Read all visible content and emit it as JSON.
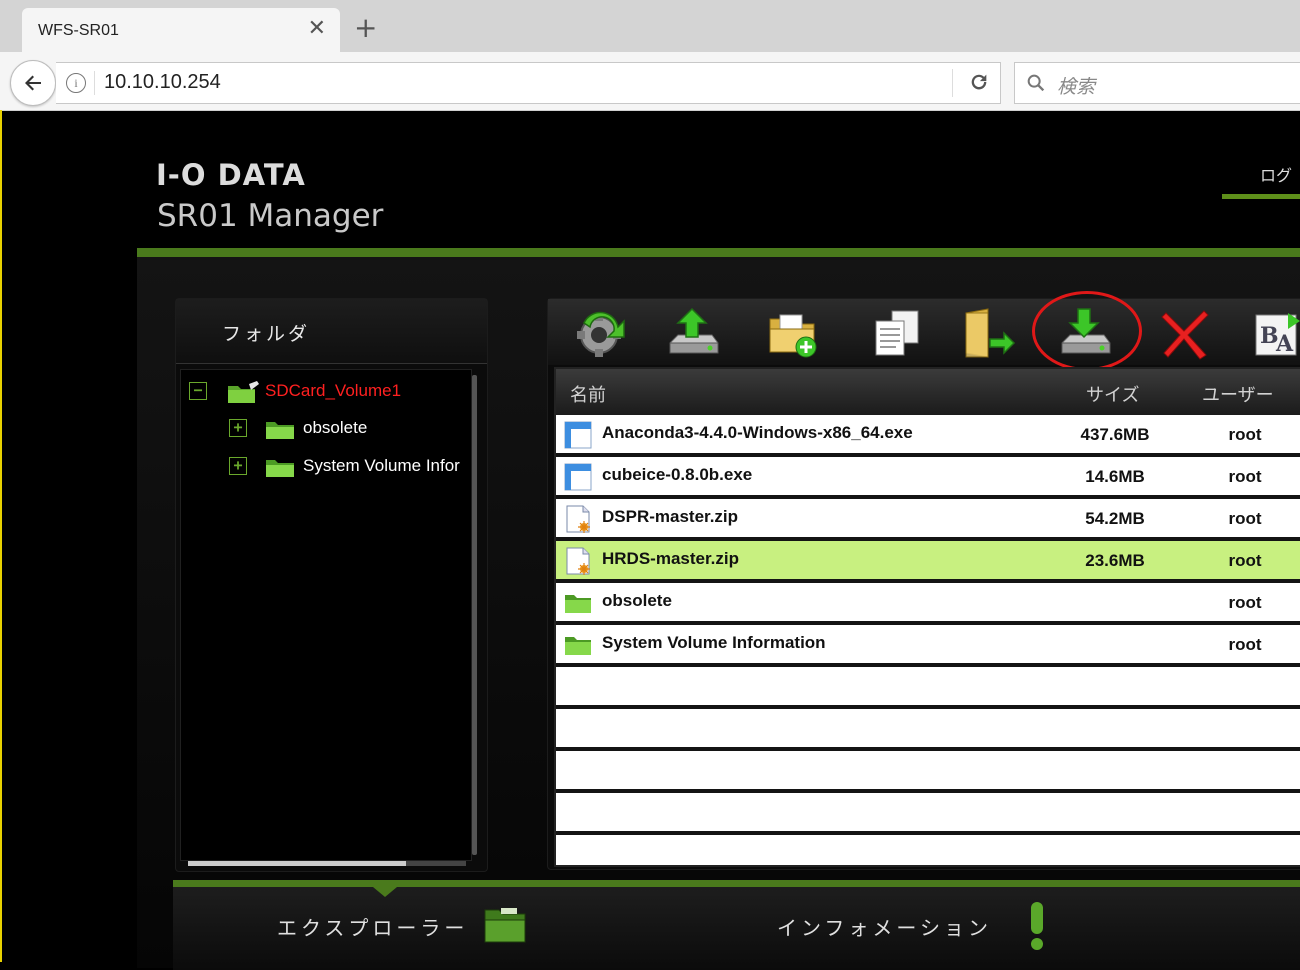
{
  "browser": {
    "tab_title": "WFS-SR01",
    "tab_close": "✕",
    "new_tab": "+",
    "url": "10.10.10.254",
    "search_placeholder": "検索"
  },
  "app": {
    "logo": "I-O DATA",
    "app_name": "SR01 Manager",
    "login_tab": "ログ"
  },
  "folder_panel": {
    "title": "フォルダ",
    "tree": [
      {
        "label": "SDCard_Volume1",
        "toggle": "−",
        "color": "#ff2020"
      },
      {
        "label": "obsolete",
        "toggle": "+",
        "color": "#ffffff"
      },
      {
        "label": "System Volume Infor",
        "toggle": "+",
        "color": "#ffffff"
      }
    ]
  },
  "action_bar": {
    "items": [
      "refresh-icon",
      "upload-icon",
      "new-folder-icon",
      "copy-icon",
      "move-icon",
      "download-icon",
      "delete-icon",
      "rename-icon"
    ]
  },
  "file_list": {
    "columns": {
      "name": "名前",
      "size": "サイズ",
      "user": "ユーザー"
    },
    "rows": [
      {
        "name": "Anaconda3-4.4.0-Windows-x86_64.exe",
        "size": "437.6MB",
        "user": "root",
        "type": "exe",
        "selected": false
      },
      {
        "name": "cubeice-0.8.0b.exe",
        "size": "14.6MB",
        "user": "root",
        "type": "exe",
        "selected": false
      },
      {
        "name": "DSPR-master.zip",
        "size": "54.2MB",
        "user": "root",
        "type": "zip",
        "selected": false
      },
      {
        "name": "HRDS-master.zip",
        "size": "23.6MB",
        "user": "root",
        "type": "zip",
        "selected": true
      },
      {
        "name": "obsolete",
        "size": "",
        "user": "root",
        "type": "folder",
        "selected": false
      },
      {
        "name": "System Volume Information",
        "size": "",
        "user": "root",
        "type": "folder",
        "selected": false
      }
    ],
    "empty_rows": 4
  },
  "bottom_nav": {
    "explorer": "エクスプローラー",
    "information": "インフォメーション"
  },
  "colors": {
    "accent_green": "#4a7a1c",
    "selected_row": "#c8f080",
    "tree_root_red": "#ff2020",
    "highlight_ring": "#e01818"
  }
}
